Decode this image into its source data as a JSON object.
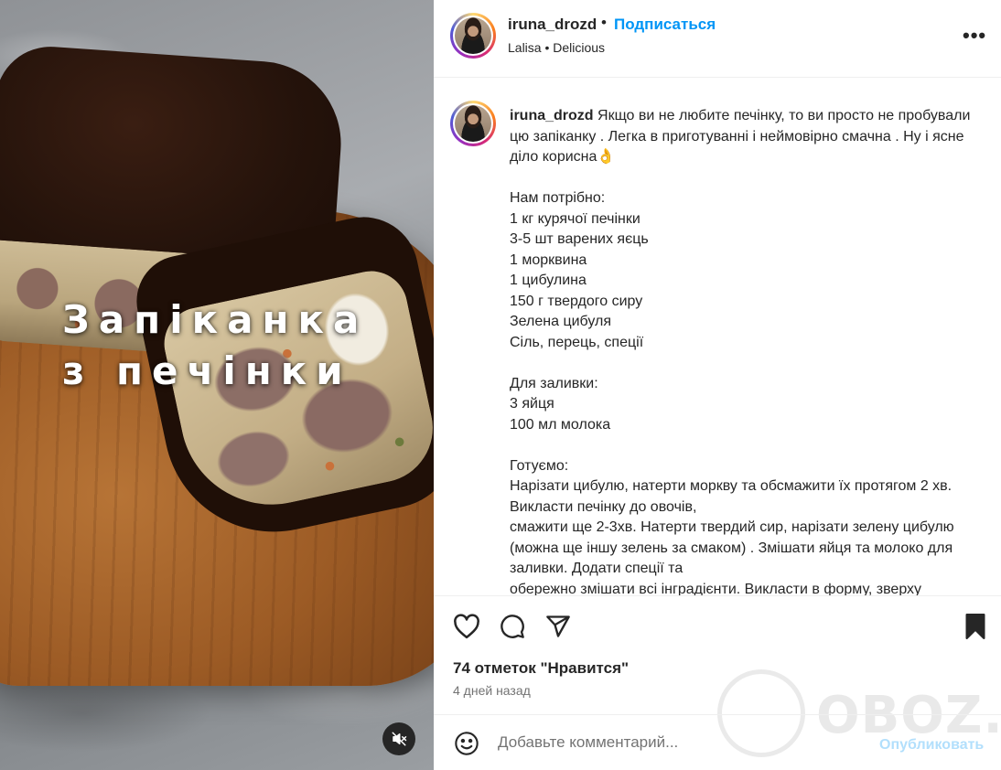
{
  "media": {
    "overlay_text": "Запіканка\nз печінки",
    "mute_icon": "speaker-muted-icon"
  },
  "header": {
    "username": "iruna_drozd",
    "separator": "•",
    "follow_label": "Подписаться",
    "audio_label": "Lalisa • Delicious",
    "more_icon": "more-options-icon",
    "more_glyph": "•••"
  },
  "caption": {
    "username": "iruna_drozd",
    "text": " Якщо ви не любите печінку, то ви просто не пробували цю запіканку . Легка в приготуванні і неймовірно смачна . Ну і ясне діло корисна👌\n\nНам потрібно:\n1 кг курячої печінки\n3-5 шт варених яєць\n1 морквина\n1 цибулина\n150 г твердого сиру\nЗелена цибуля\nСіль, перець, спеції\n\nДля заливки:\n3 яйця\n100 мл молока\n\nГотуємо:\nНарізати цибулю, натерти моркву та обсмажити їх протягом 2 хв. Викласти печінку до овочів,\nсмажити ще 2-3хв. Натерти твердий сир, нарізати зелену цибулю (можна ще іншу зелень за смаком) . Змішати яйця та молоко для заливки. Додати спеції та\nобережно змішати всі інградієнти. Викласти в форму, зверху"
  },
  "actions": {
    "like_icon": "heart-icon",
    "comment_icon": "comment-icon",
    "share_icon": "share-icon",
    "save_icon": "bookmark-icon",
    "likes_text": "74 отметок \"Нравится\"",
    "time_text": "4 дней назад"
  },
  "comment": {
    "emoji_icon": "emoji-icon",
    "placeholder": "Добавьте комментарий...",
    "publish_label": "Опубликовать"
  },
  "watermark": {
    "text": "OBOZ.UA"
  },
  "colors": {
    "accent": "#0095f6",
    "publish_disabled": "#b2dffc",
    "text_primary": "#262626",
    "text_secondary": "#737373",
    "divider": "#efefef"
  }
}
